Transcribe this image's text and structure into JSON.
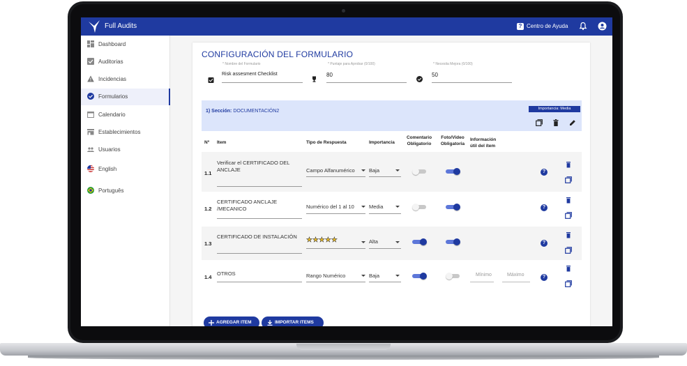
{
  "app": {
    "title": "Full Audits"
  },
  "header": {
    "help_label": "Centro de Ayuda"
  },
  "sidebar": {
    "items": [
      {
        "label": "Dashboard",
        "icon": "dashboard-icon"
      },
      {
        "label": "Auditorias",
        "icon": "checkbox-icon"
      },
      {
        "label": "Incidencias",
        "icon": "warning-icon"
      },
      {
        "label": "Formularios",
        "icon": "check-circle-icon",
        "active": true
      },
      {
        "label": "Calendario",
        "icon": "calendar-icon"
      },
      {
        "label": "Establecimientos",
        "icon": "store-icon"
      },
      {
        "label": "Usuarios",
        "icon": "users-icon"
      },
      {
        "label": "English",
        "icon": "us-flag-icon"
      },
      {
        "label": "Português",
        "icon": "brazil-flag-icon"
      }
    ]
  },
  "form": {
    "title": "CONFIGURACIÓN DEL FORMULARIO",
    "name_hint": "* Nombre del Formulario",
    "name_value": "Risk assesment Checklist",
    "pass_hint": "* Puntaje para Aprobar (0/100)",
    "pass_value": "80",
    "improve_hint": "* Necesita Mejora (0/100)",
    "improve_value": "50"
  },
  "section": {
    "prefix": "1) Sección:",
    "name": "DOCUMENTACIÓN2",
    "importance_badge": "Importancia: Media"
  },
  "columns": {
    "no": "Nº",
    "item": "Item",
    "type": "Tipo de Respuesta",
    "importance": "Importancia",
    "comment_1": "Comentario",
    "comment_2": "Obligatorio",
    "photo_1": "Foto/Video",
    "photo_2": "Obligatoria",
    "info_1": "Información",
    "info_2": "útil del ítem"
  },
  "rows": [
    {
      "no": "1.1",
      "item": "Verificar el CERTIFICADO DEL ANCLAJE",
      "type": "Campo Alfanumérico",
      "importance": "Baja",
      "comment": false,
      "photo": true
    },
    {
      "no": "1.2",
      "item": "CERTIFICADO ANCLAJE /MECANICO",
      "type": "Numérico del 1 al 10",
      "importance": "Media",
      "comment": false,
      "photo": true
    },
    {
      "no": "1.3",
      "item": "CERTIFICADO DE INSTALACIÓN",
      "type": "★★★★★",
      "importance": "Alta",
      "comment": true,
      "photo": true
    },
    {
      "no": "1.4",
      "item": "OTROS",
      "type": "Rango Numérico",
      "importance": "Baja",
      "comment": true,
      "photo": false,
      "min": "Mínimo",
      "max": "Máximo"
    }
  ],
  "actions": {
    "add_item": "AGREGAR ITEM",
    "import_items": "IMPORTAR ITEMS"
  },
  "colors": {
    "primary": "#1f3aa0",
    "section_bg": "#dce5fb"
  }
}
